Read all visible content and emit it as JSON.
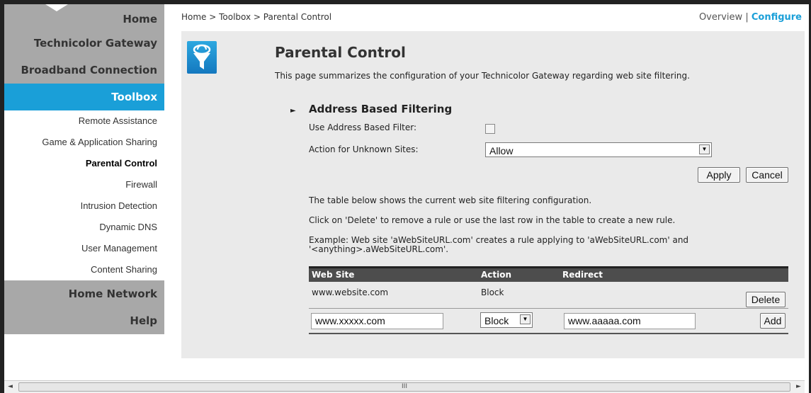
{
  "sidebar": {
    "home": "Home",
    "gateway": "Technicolor Gateway",
    "broadband": "Broadband Connection",
    "toolbox": "Toolbox",
    "sub_items": [
      "Remote Assistance",
      "Game & Application Sharing",
      "Parental Control",
      "Firewall",
      "Intrusion Detection",
      "Dynamic DNS",
      "User Management",
      "Content Sharing"
    ],
    "home_network": "Home Network",
    "help": "Help"
  },
  "breadcrumb": "Home > Toolbox > Parental Control",
  "view_links": {
    "overview": "Overview",
    "separator": "|",
    "configure": "Configure"
  },
  "page": {
    "title": "Parental Control",
    "description": "This page summarizes the configuration of your Technicolor Gateway regarding web site filtering."
  },
  "section": {
    "arrow": "►",
    "title": "Address Based Filtering",
    "use_filter_label": "Use Address Based Filter:",
    "use_filter_checked": false,
    "unknown_label": "Action for Unknown Sites:",
    "unknown_value": "Allow",
    "apply_label": "Apply",
    "cancel_label": "Cancel"
  },
  "info": {
    "line1": "The table below shows the current web site filtering configuration.",
    "line2": "Click on 'Delete' to remove a rule or use the last row in the table to create a new rule.",
    "line3": "Example: Web site 'aWebSiteURL.com' creates a rule applying to 'aWebSiteURL.com' and '<anything>.aWebSiteURL.com'."
  },
  "table": {
    "headers": {
      "website": "Web Site",
      "action": "Action",
      "redirect": "Redirect"
    },
    "rows": [
      {
        "website": "www.website.com",
        "action": "Block",
        "redirect": "",
        "button": "Delete"
      }
    ],
    "new_row": {
      "website": "www.xxxxx.com",
      "action": "Block",
      "redirect": "www.aaaaa.com",
      "button": "Add"
    }
  },
  "scrollbar": {
    "grip": "III",
    "left_arrow": "◄",
    "right_arrow": "►"
  },
  "colors": {
    "accent": "#1a9fd8",
    "nav_bg": "#a8a8a8",
    "panel_bg": "#eaeaea",
    "table_header": "#4d4d4d"
  }
}
